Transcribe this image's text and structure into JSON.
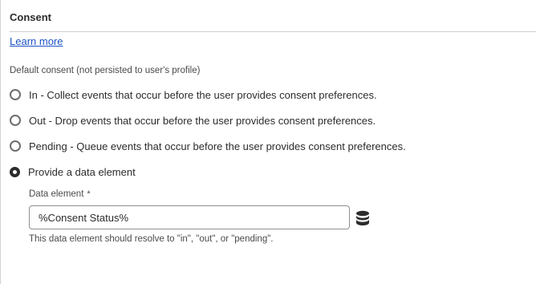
{
  "section": {
    "title": "Consent",
    "learn_more": "Learn more"
  },
  "default_consent": {
    "group_label": "Default consent (not persisted to user's profile)",
    "options": [
      {
        "label": "In - Collect events that occur before the user provides consent preferences.",
        "selected": false
      },
      {
        "label": "Out - Drop events that occur before the user provides consent preferences.",
        "selected": false
      },
      {
        "label": "Pending - Queue events that occur before the user provides consent preferences.",
        "selected": false
      },
      {
        "label": "Provide a data element",
        "selected": true
      }
    ]
  },
  "data_element": {
    "label": "Data element",
    "required_mark": "*",
    "value": "%Consent Status%",
    "help_text": "This data element should resolve to \"in\", \"out\", or \"pending\".",
    "picker_icon": "database-icon"
  },
  "colors": {
    "link": "#1d52c4",
    "text": "#2c2c2c",
    "muted_text": "#4b4b4b",
    "radio_border": "#6e6e6e",
    "input_border": "#8f8f8f",
    "divider": "#cfcfcf"
  }
}
